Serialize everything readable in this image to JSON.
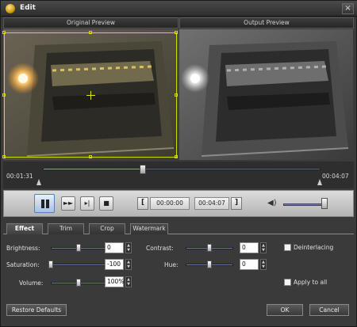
{
  "window": {
    "title": "Edit",
    "close_glyph": "×"
  },
  "preview": {
    "original_label": "Original Preview",
    "output_label": "Output Preview"
  },
  "timeline": {
    "current_time": "00:01:31",
    "total_time": "00:04:07",
    "position": 0.36
  },
  "controls": {
    "start_time": "00:00:00",
    "end_time": "00:04:07",
    "left_bracket": "[",
    "right_bracket": "]",
    "volume_level": 0.92
  },
  "tabs": [
    "Effect",
    "Trim",
    "Crop",
    "Watermark"
  ],
  "active_tab": "Effect",
  "effects": {
    "brightness": {
      "label": "Brightness:",
      "value": "0",
      "level": 0.5
    },
    "contrast": {
      "label": "Contrast:",
      "value": "0",
      "level": 0.5
    },
    "saturation": {
      "label": "Saturation:",
      "value": "-100",
      "level": 0.0
    },
    "hue": {
      "label": "Hue:",
      "value": "0",
      "level": 0.5
    },
    "volume": {
      "label": "Volume:",
      "value": "100%",
      "level": 0.5
    },
    "deinterlacing_label": "Deinterlacing",
    "apply_all_label": "Apply to all"
  },
  "footer": {
    "restore_label": "Restore Defaults",
    "ok_label": "OK",
    "cancel_label": "Cancel"
  }
}
